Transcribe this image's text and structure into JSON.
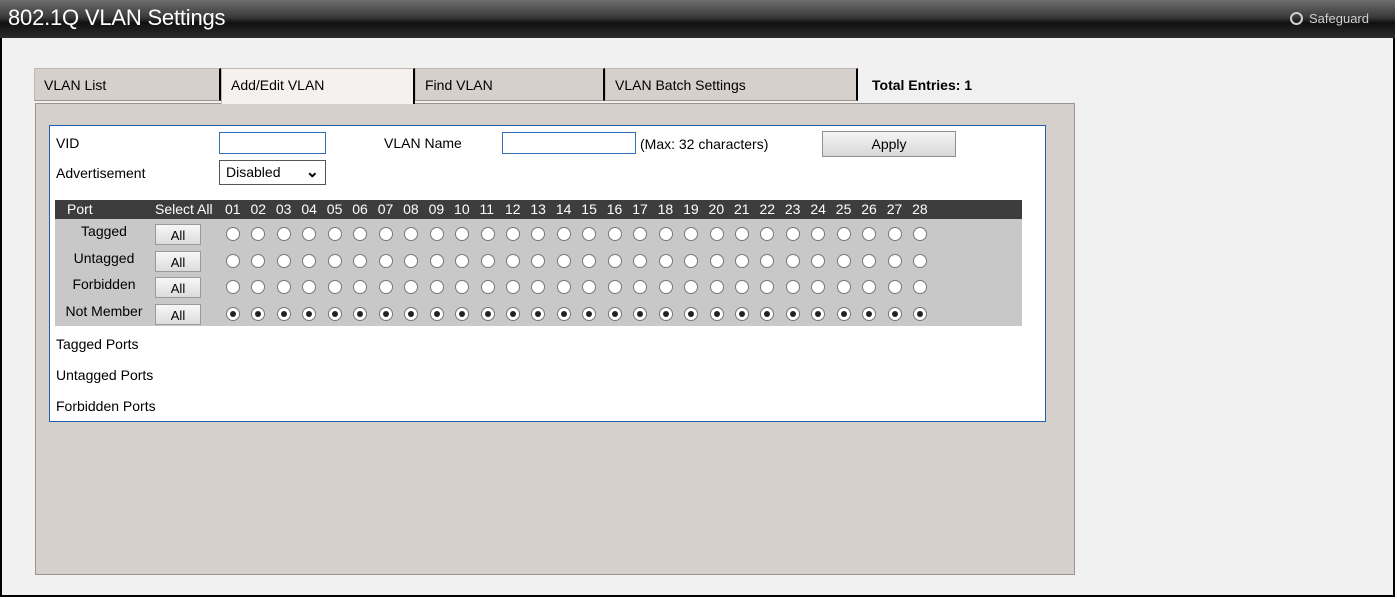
{
  "window": {
    "title": "802.1Q VLAN Settings",
    "safeguard_label": "Safeguard"
  },
  "tabs": [
    {
      "label": "VLAN List",
      "active": false
    },
    {
      "label": "Add/Edit VLAN",
      "active": true
    },
    {
      "label": "Find VLAN",
      "active": false
    },
    {
      "label": "VLAN Batch Settings",
      "active": false
    }
  ],
  "total_entries": "Total Entries: 1",
  "form": {
    "vid_label": "VID",
    "vid_value": "",
    "vlan_name_label": "VLAN Name",
    "vlan_name_value": "",
    "vlan_name_hint": "(Max: 32 characters)",
    "apply_label": "Apply",
    "advertisement_label": "Advertisement",
    "advertisement_value": "Disabled"
  },
  "port_table": {
    "port_header": "Port",
    "select_all_header": "Select All",
    "ports": [
      "01",
      "02",
      "03",
      "04",
      "05",
      "06",
      "07",
      "08",
      "09",
      "10",
      "11",
      "12",
      "13",
      "14",
      "15",
      "16",
      "17",
      "18",
      "19",
      "20",
      "21",
      "22",
      "23",
      "24",
      "25",
      "26",
      "27",
      "28"
    ],
    "rows": [
      {
        "label": "Tagged",
        "all_label": "All",
        "selected": false
      },
      {
        "label": "Untagged",
        "all_label": "All",
        "selected": false
      },
      {
        "label": "Forbidden",
        "all_label": "All",
        "selected": false
      },
      {
        "label": "Not Member",
        "all_label": "All",
        "selected": true
      }
    ]
  },
  "summary": {
    "tagged_ports_label": "Tagged Ports",
    "untagged_ports_label": "Untagged Ports",
    "forbidden_ports_label": "Forbidden Ports"
  }
}
